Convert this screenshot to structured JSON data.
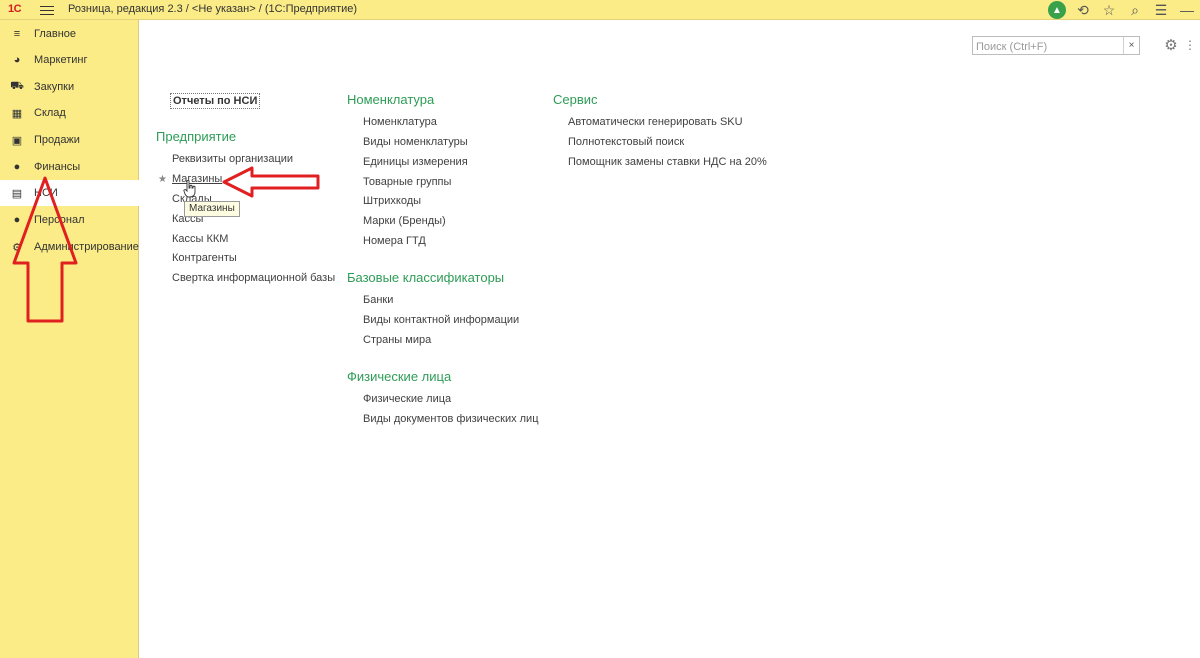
{
  "titlebar": {
    "logo": "1С",
    "title": "Розница, редакция 2.3 / <Не указан> /  (1С:Предприятие)",
    "icons": [
      "tree-icon",
      "history-icon",
      "star-icon",
      "search-icon",
      "menu-icon",
      "minimize-icon"
    ]
  },
  "sidebar": {
    "items": [
      {
        "label": "Главное",
        "icon": "menu-lines-icon"
      },
      {
        "label": "Маркетинг",
        "icon": "pie-icon"
      },
      {
        "label": "Закупки",
        "icon": "cart-icon"
      },
      {
        "label": "Склад",
        "icon": "grid-icon"
      },
      {
        "label": "Продажи",
        "icon": "bag-icon"
      },
      {
        "label": "Финансы",
        "icon": "coin-icon"
      },
      {
        "label": "НСИ",
        "icon": "books-icon",
        "active": true
      },
      {
        "label": "Персонал",
        "icon": "person-icon"
      },
      {
        "label": "Администрирование",
        "icon": "gear-icon"
      }
    ]
  },
  "search": {
    "placeholder": "Поиск (Ctrl+F)",
    "value": "",
    "clear": "×"
  },
  "content": {
    "reports_button": "Отчеты по НСИ",
    "col1": {
      "title": "Предприятие",
      "links": [
        "Реквизиты организации",
        "Магазины",
        "Склады",
        "Кассы",
        "Кассы ККМ",
        "Контрагенты",
        "Свертка информационной базы"
      ]
    },
    "col2": {
      "sections": [
        {
          "title": "Номенклатура",
          "links": [
            "Номенклатура",
            "Виды номенклатуры",
            "Единицы измерения",
            "Товарные группы",
            "Штрихкоды",
            "Марки (Бренды)",
            "Номера ГТД"
          ]
        },
        {
          "title": "Базовые классификаторы",
          "links": [
            "Банки",
            "Виды контактной информации",
            "Страны мира"
          ]
        },
        {
          "title": "Физические лица",
          "links": [
            "Физические лица",
            "Виды документов физических лиц"
          ]
        }
      ]
    },
    "col3": {
      "title": "Сервис",
      "links": [
        "Автоматически генерировать SKU",
        "Полнотекстовый поиск",
        "Помощник замены ставки НДС на 20%"
      ]
    },
    "tooltip": "Магазины"
  },
  "colors": {
    "panel": "#fbec88",
    "section": "#2e9c57",
    "arrow": "#e02020"
  }
}
